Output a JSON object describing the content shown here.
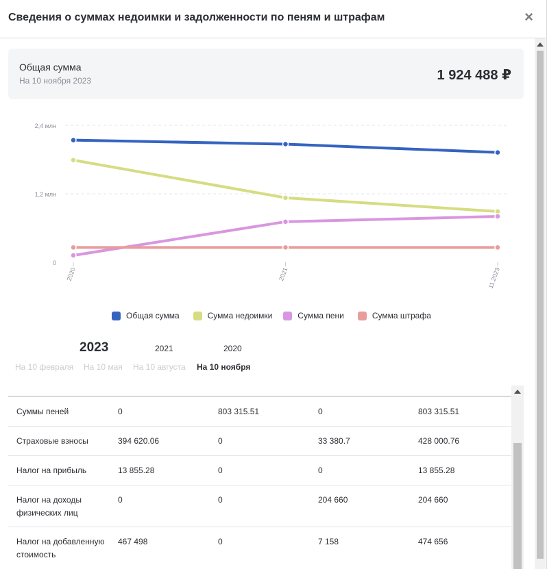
{
  "modal": {
    "title": "Сведения о суммах недоимки и задолженности по пеням и штрафам",
    "close_icon": "×"
  },
  "summary": {
    "label": "Общая сумма",
    "date": "На 10 ноября 2023",
    "value": "1 924 488 ₽"
  },
  "chart_data": {
    "type": "line",
    "x": [
      "2020",
      "2021",
      "11.2023"
    ],
    "y_ticks": [
      "0",
      "1,2 млн",
      "2,4 млн"
    ],
    "ylim": [
      0,
      2400000
    ],
    "grid": true,
    "legend_position": "bottom",
    "series": [
      {
        "name": "Общая сумма",
        "color": "#3563c0",
        "values": [
          2140000,
          2070000,
          1924488
        ]
      },
      {
        "name": "Сумма недоимки",
        "color": "#d6dc82",
        "values": [
          1790000,
          1130000,
          890000
        ]
      },
      {
        "name": "Сумма пени",
        "color": "#d996e0",
        "values": [
          120000,
          710000,
          803315.51
        ]
      },
      {
        "name": "Сумма штрафа",
        "color": "#e89c9c",
        "values": [
          260000,
          260000,
          260000
        ]
      }
    ]
  },
  "years": {
    "active": "2023",
    "others": [
      "2021",
      "2020"
    ]
  },
  "periods": [
    "На 10 февраля",
    "На 10 мая",
    "На 10 августа",
    "На 10 ноября"
  ],
  "table": {
    "rows": [
      {
        "name": "Суммы пеней",
        "v1": "0",
        "v2": "803 315.51",
        "v3": "0",
        "v4": "803 315.51"
      },
      {
        "name": "Страховые взносы",
        "v1": "394 620.06",
        "v2": "0",
        "v3": "33 380.7",
        "v4": "428 000.76"
      },
      {
        "name": "Налог на прибыль",
        "v1": "13 855.28",
        "v2": "0",
        "v3": "0",
        "v4": "13 855.28"
      },
      {
        "name": "Налог на доходы физических лиц",
        "v1": "0",
        "v2": "0",
        "v3": "204 660",
        "v4": "204 660"
      },
      {
        "name": "Налог на добавленную стоимость",
        "v1": "467 498",
        "v2": "0",
        "v3": "7 158",
        "v4": "474 656"
      }
    ]
  }
}
